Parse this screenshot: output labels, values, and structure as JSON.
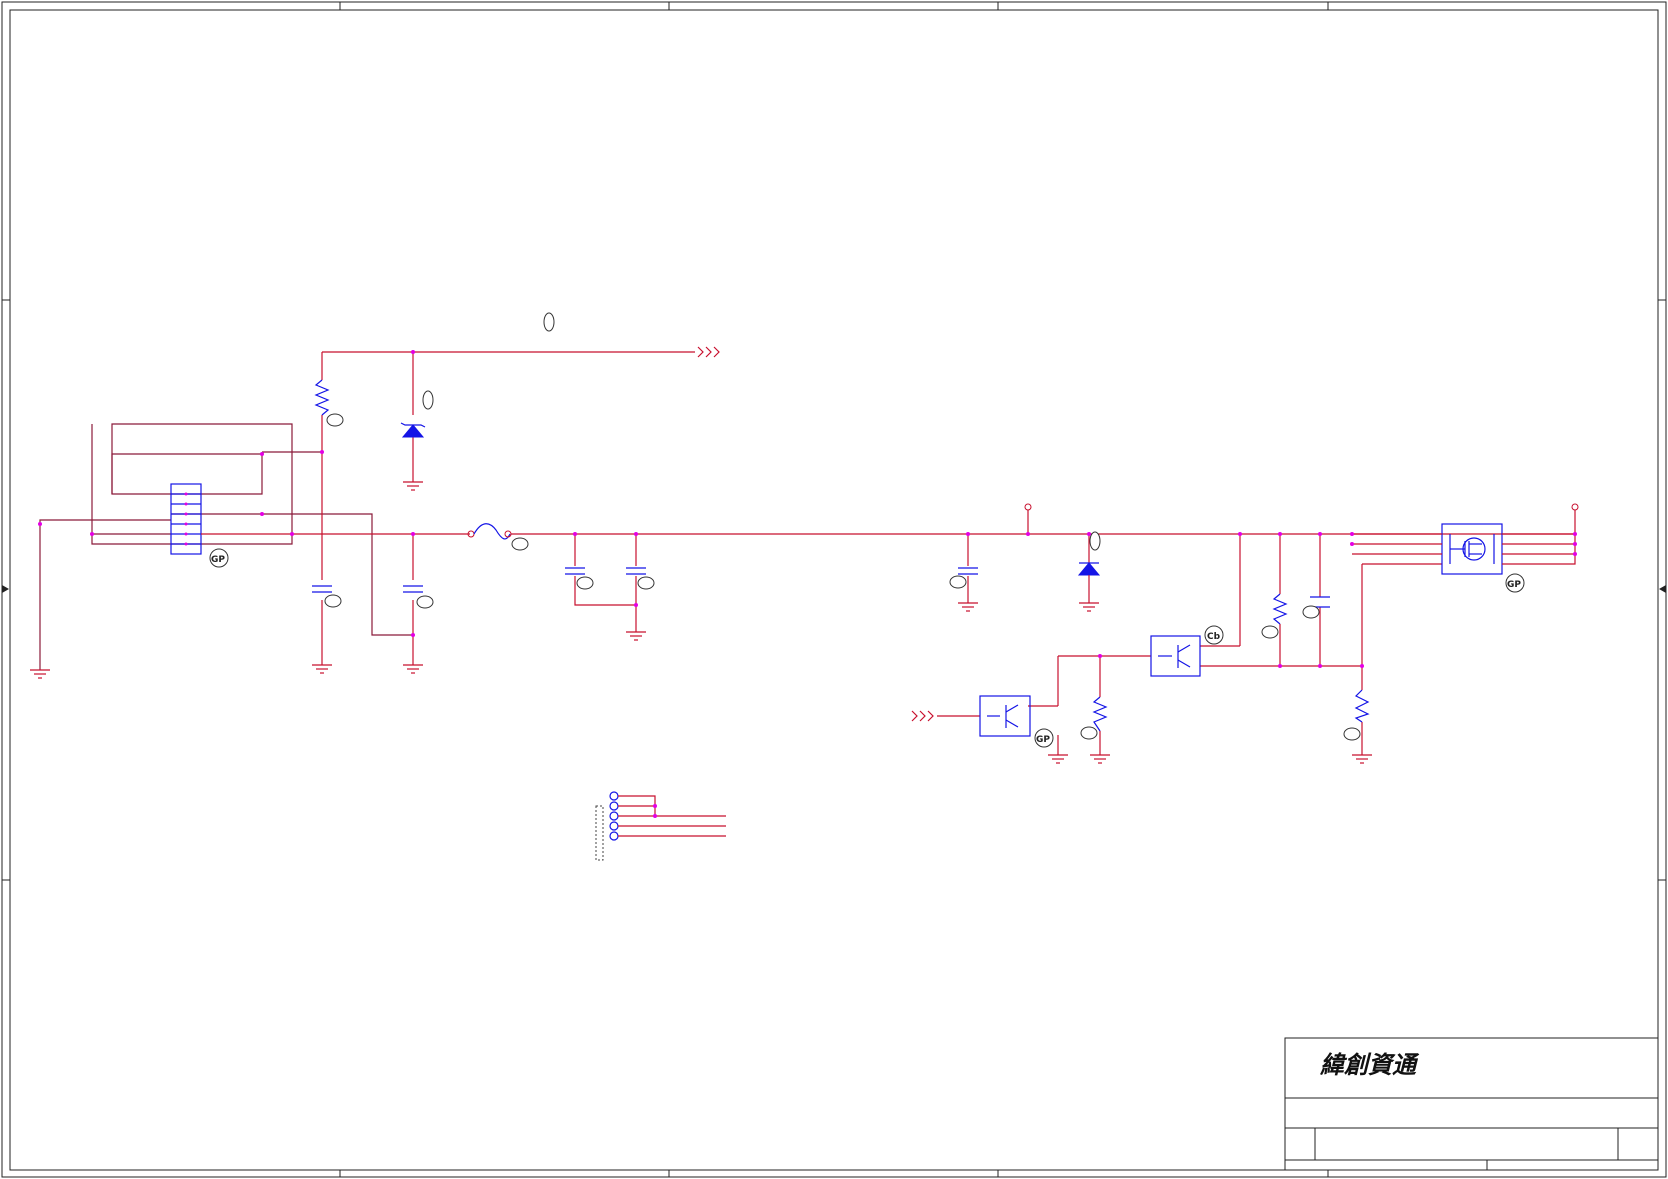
{
  "title_block": {
    "company_name": "緯創資通"
  },
  "part_badges": {
    "connector": "GP",
    "mosfet": "GP",
    "optocoupler_left": "GP",
    "optocoupler_right": "Cb"
  },
  "colors": {
    "wire": "#c8102e",
    "net_loop": "#8b1a3a",
    "component": "#1414e6",
    "junction": "#e400e4"
  },
  "icons": {
    "ground": "ground-symbol-icon",
    "offpage": "offpage-arrow-icon",
    "zener": "zener-diode-icon",
    "fuse": "fuse-icon"
  }
}
